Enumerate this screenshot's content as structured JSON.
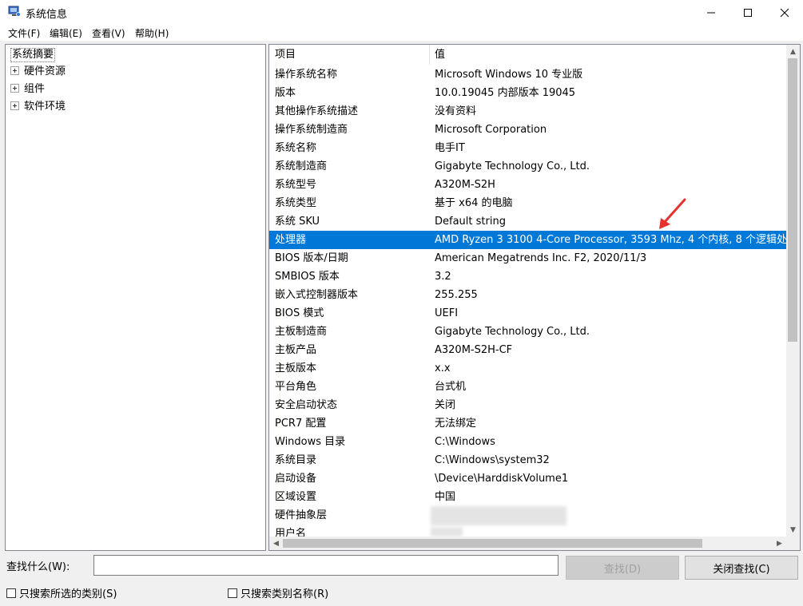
{
  "window": {
    "title": "系统信息"
  },
  "menu": [
    "文件(F)",
    "编辑(E)",
    "查看(V)",
    "帮助(H)"
  ],
  "tree": {
    "root": "系统摘要",
    "children": [
      "硬件资源",
      "组件",
      "软件环境"
    ]
  },
  "list": {
    "headers": {
      "item": "项目",
      "value": "值"
    },
    "rows": [
      {
        "item": "操作系统名称",
        "value": "Microsoft Windows 10 专业版"
      },
      {
        "item": "版本",
        "value": "10.0.19045 内部版本 19045"
      },
      {
        "item": "其他操作系统描述",
        "value": "没有资料"
      },
      {
        "item": "操作系统制造商",
        "value": "Microsoft Corporation"
      },
      {
        "item": "系统名称",
        "value": "电手IT"
      },
      {
        "item": "系统制造商",
        "value": "Gigabyte Technology Co., Ltd."
      },
      {
        "item": "系统型号",
        "value": "A320M-S2H"
      },
      {
        "item": "系统类型",
        "value": "基于 x64 的电脑"
      },
      {
        "item": "系统 SKU",
        "value": "Default string"
      },
      {
        "item": "处理器",
        "value": "AMD Ryzen 3 3100 4-Core Processor, 3593 Mhz, 4 个内核, 8 个逻辑处"
      },
      {
        "item": "BIOS 版本/日期",
        "value": "American Megatrends Inc. F2, 2020/11/3"
      },
      {
        "item": "SMBIOS 版本",
        "value": "3.2"
      },
      {
        "item": "嵌入式控制器版本",
        "value": "255.255"
      },
      {
        "item": "BIOS 模式",
        "value": "UEFI"
      },
      {
        "item": "主板制造商",
        "value": "Gigabyte Technology Co., Ltd."
      },
      {
        "item": "主板产品",
        "value": "A320M-S2H-CF"
      },
      {
        "item": "主板版本",
        "value": "x.x"
      },
      {
        "item": "平台角色",
        "value": "台式机"
      },
      {
        "item": "安全启动状态",
        "value": "关闭"
      },
      {
        "item": "PCR7 配置",
        "value": "无法绑定"
      },
      {
        "item": "Windows 目录",
        "value": "C:\\Windows"
      },
      {
        "item": "系统目录",
        "value": "C:\\Windows\\system32"
      },
      {
        "item": "启动设备",
        "value": "\\Device\\HarddiskVolume1"
      },
      {
        "item": "区域设置",
        "value": "中国"
      },
      {
        "item": "硬件抽象层",
        "value": ""
      },
      {
        "item": "用户名",
        "value": ""
      }
    ],
    "selected_index": 9
  },
  "find": {
    "label": "查找什么(W):",
    "value": "",
    "find_button": "查找(D)",
    "close_find_button": "关闭查找(C)",
    "checkbox_selected_category": "只搜索所选的类别(S)",
    "checkbox_category_names": "只搜索类别名称(R)"
  },
  "colors": {
    "selection": "#0078d7",
    "annotation_arrow": "#e5322d"
  }
}
